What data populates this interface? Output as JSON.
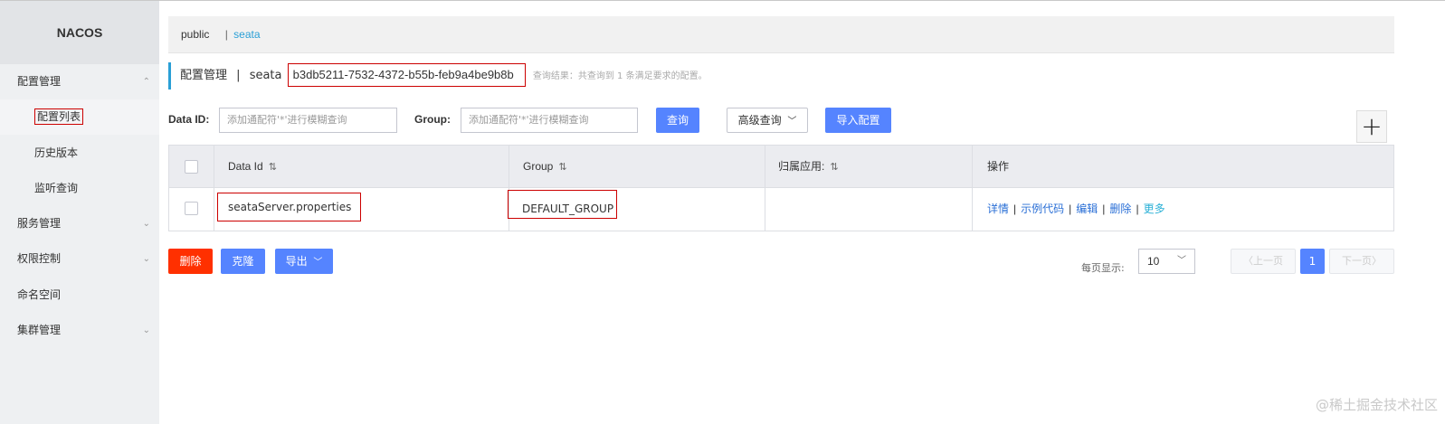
{
  "app": {
    "brand": "NACOS"
  },
  "sidebar": {
    "items": [
      {
        "label": "配置管理",
        "chevron": "⌃"
      },
      {
        "label": "配置列表"
      },
      {
        "label": "历史版本"
      },
      {
        "label": "监听查询"
      },
      {
        "label": "服务管理",
        "chevron": "⌄"
      },
      {
        "label": "权限控制",
        "chevron": "⌄"
      },
      {
        "label": "命名空间"
      },
      {
        "label": "集群管理",
        "chevron": "⌄"
      }
    ]
  },
  "namespace_bar": {
    "public": "public",
    "separator": "|",
    "active": "seata"
  },
  "title": {
    "section": "配置管理",
    "separator": "|",
    "namespace": "seata",
    "namespace_id": "b3db5211-7532-4372-b55b-feb9a4be9b8b",
    "result": "查询结果：共查询到 1 条满足要求的配置。"
  },
  "filters": {
    "data_id_label": "Data ID:",
    "data_id_placeholder": "添加通配符'*'进行模糊查询",
    "group_label": "Group:",
    "group_placeholder": "添加通配符'*'进行模糊查询",
    "query_button": "查询",
    "advanced_query": "高级查询",
    "import_button": "导入配置",
    "add_symbol": "+"
  },
  "table": {
    "headers": {
      "data_id": "Data Id",
      "group": "Group",
      "app": "归属应用:",
      "ops": "操作"
    },
    "sort_icon": "⇅",
    "rows": [
      {
        "data_id": "seataServer.properties",
        "group": "DEFAULT_GROUP",
        "app": "",
        "ops": {
          "detail": "详情",
          "sample": "示例代码",
          "edit": "编辑",
          "delete": "删除",
          "more": "更多"
        }
      }
    ],
    "ops_separator": "|"
  },
  "bulk_actions": {
    "delete": "删除",
    "clone": "克隆",
    "export": "导出"
  },
  "pagination": {
    "per_page_label": "每页显示:",
    "per_page_value": "10",
    "prev": "上一页",
    "current": "1",
    "next": "下一页"
  },
  "watermark": "@稀土掘金技术社区",
  "colors": {
    "primary": "#5584ff",
    "danger": "#ff3000",
    "link": "#2a6fd6",
    "accent": "#2a9fd6",
    "sidebar_bg": "#eef0f2"
  }
}
